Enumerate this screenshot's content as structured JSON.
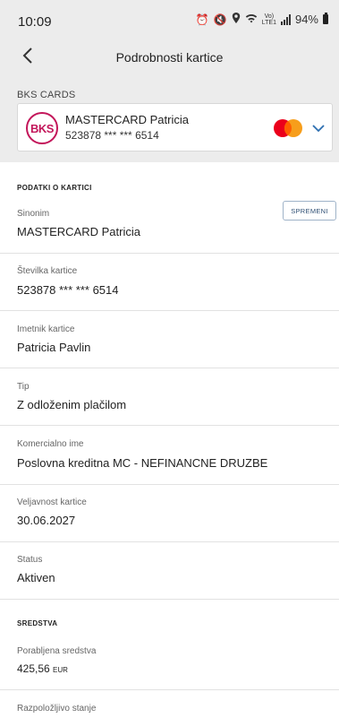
{
  "status_bar": {
    "time": "10:09",
    "lte_top": "Vo)",
    "lte_bottom": "LTE1",
    "battery": "94%"
  },
  "header": {
    "title": "Podrobnosti kartice"
  },
  "cards": {
    "section_label": "BKS CARDS",
    "logo_text": "BKS",
    "selected_card_name": "MASTERCARD Patricia",
    "selected_card_number": "523878 *** *** 6514"
  },
  "card_details": {
    "section_title": "PODATKI O KARTICI",
    "edit_button": "SPREMENI",
    "fields": [
      {
        "label": "Sinonim",
        "value": "MASTERCARD Patricia"
      },
      {
        "label": "Številka kartice",
        "value": "523878 *** *** 6514"
      },
      {
        "label": "Imetnik kartice",
        "value": "Patricia Pavlin"
      },
      {
        "label": "Tip",
        "value": "Z odloženim plačilom"
      },
      {
        "label": "Komercialno ime",
        "value": "Poslovna kreditna MC - NEFINANCNE DRUZBE"
      },
      {
        "label": "Veljavnost kartice",
        "value": "30.06.2027"
      },
      {
        "label": "Status",
        "value": "Aktiven"
      }
    ]
  },
  "funds": {
    "section_title": "SREDSTVA",
    "used_label": "Porabljena sredstva",
    "used_amount": "425,56",
    "used_currency": "EUR",
    "available_label": "Razpoložljivo stanje"
  },
  "colors": {
    "brand_magenta": "#c3165a",
    "accent_blue": "#2d6fb0",
    "mastercard_red": "#eb001b",
    "mastercard_orange": "#f79e1b"
  }
}
